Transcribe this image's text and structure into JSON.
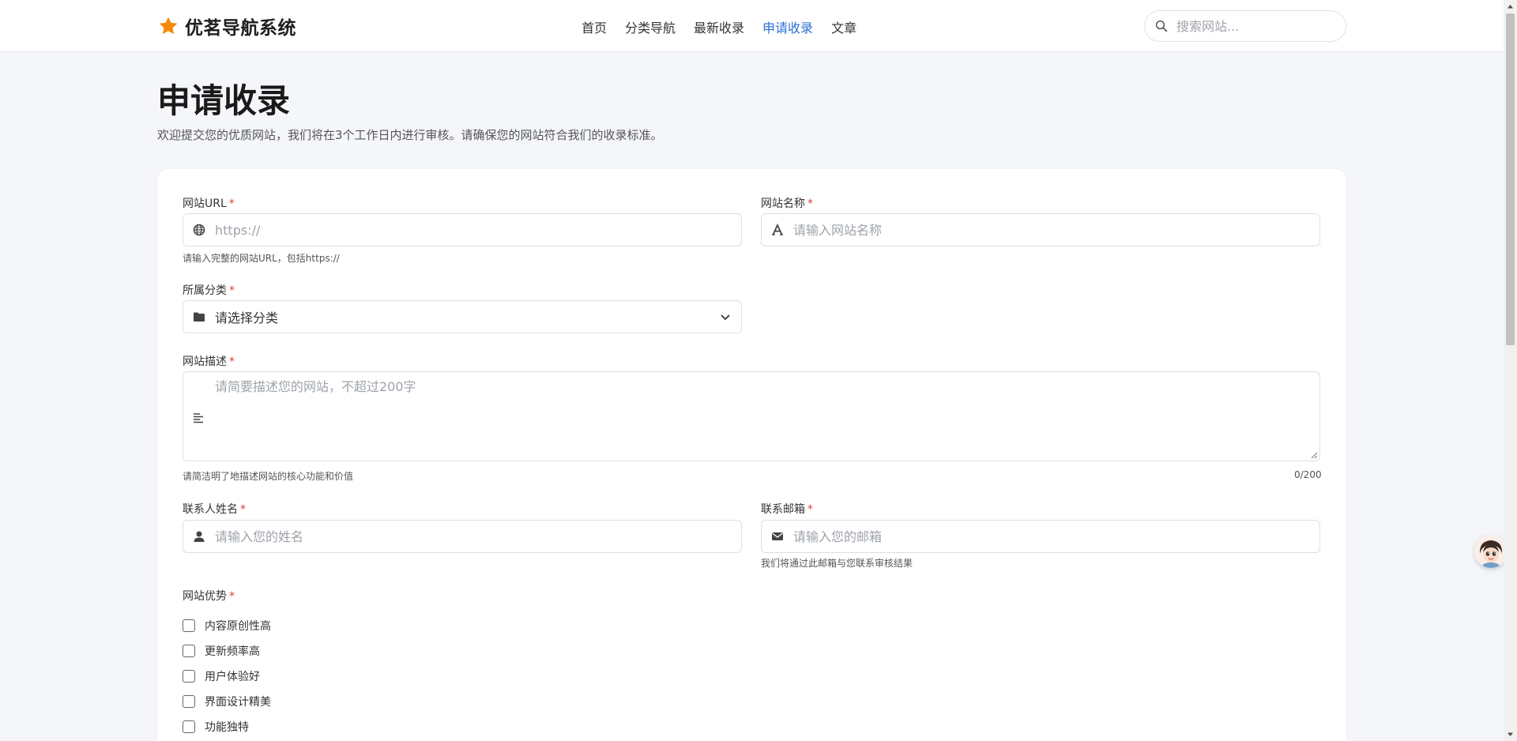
{
  "header": {
    "brand": "优茗导航系统",
    "nav": [
      {
        "label": "首页",
        "active": false
      },
      {
        "label": "分类导航",
        "active": false
      },
      {
        "label": "最新收录",
        "active": false
      },
      {
        "label": "申请收录",
        "active": true
      },
      {
        "label": "文章",
        "active": false
      }
    ],
    "search_placeholder": "搜索网站..."
  },
  "page": {
    "title": "申请收录",
    "subtitle": "欢迎提交您的优质网站，我们将在3个工作日内进行审核。请确保您的网站符合我们的收录标准。"
  },
  "form": {
    "required_mark": "*",
    "url": {
      "label": "网站URL",
      "placeholder": "https://",
      "hint": "请输入完整的网站URL，包括https://"
    },
    "name": {
      "label": "网站名称",
      "placeholder": "请输入网站名称"
    },
    "category": {
      "label": "所属分类",
      "selected": "请选择分类"
    },
    "description": {
      "label": "网站描述",
      "placeholder": "请简要描述您的网站，不超过200字",
      "hint": "请简洁明了地描述网站的核心功能和价值",
      "counter": "0/200"
    },
    "contact_name": {
      "label": "联系人姓名",
      "placeholder": "请输入您的姓名"
    },
    "contact_email": {
      "label": "联系邮箱",
      "placeholder": "请输入您的邮箱",
      "hint": "我们将通过此邮箱与您联系审核结果"
    },
    "advantages": {
      "label": "网站优势",
      "options": [
        "内容原创性高",
        "更新频率高",
        "用户体验好",
        "界面设计精美",
        "功能独特"
      ]
    }
  },
  "colors": {
    "accent": "#2a6fd6",
    "star": "#f5890b",
    "required": "#e53935"
  }
}
